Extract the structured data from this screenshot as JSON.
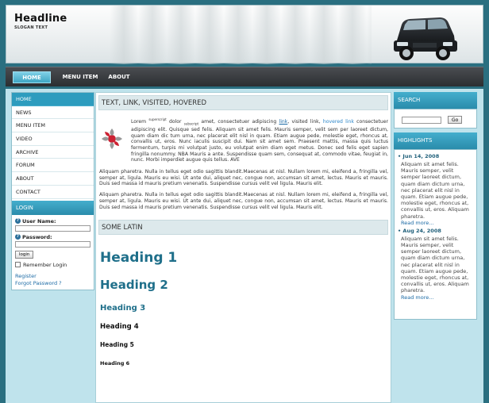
{
  "header": {
    "headline": "Headline",
    "slogan": "SLOGAN TEXT"
  },
  "nav": {
    "items": [
      {
        "label": "HOME"
      },
      {
        "label": "MENU ITEM"
      },
      {
        "label": "ABOUT"
      }
    ],
    "accent_color": "#3fa6c4"
  },
  "sidebar": {
    "items": [
      {
        "label": "HOME"
      },
      {
        "label": "NEWS"
      },
      {
        "label": "MENU ITEM"
      },
      {
        "label": "VIDEO"
      },
      {
        "label": "ARCHIVE"
      },
      {
        "label": "FORUM"
      },
      {
        "label": "ABOUT"
      },
      {
        "label": "CONTACT"
      }
    ],
    "login": {
      "title": "LOGIN",
      "username_label": "User Name:",
      "password_label": "Password:",
      "button_label": "login",
      "remember_label": "Remember Login",
      "register_link": "Register",
      "forgot_link": "Forgot Password ?"
    }
  },
  "main": {
    "section1_title": "TEXT, LINK, VISITED, HOVERED",
    "p1": {
      "t1": "Lorem ",
      "sup": "superscript",
      "t2": " dolor ",
      "sub": "subscript",
      "t3": " amet, consectetuer adipiscing ",
      "link": "link",
      "t4": ", visited link, ",
      "hover": "hovered link",
      "t5": " consectetuer adipiscing elit. Quisque sed felis. Aliquam sit amet felis. Mauris semper, velit sem per laoreet dictum, quam diam dic tum urna, nec placerat elit nisl in quam. Etiam augue pede, molestie eget, rhoncus at, convallis ut, eros. Nunc iaculis suscipit dui. Nam sit amet sem. Praesent mattis, massa quis luctus fermentum, turpis mi volutpat justo, eu volutpat enim diam eget metus. Donec sed felis eget sapien fringilla nonummy. NBA Mauris a ante. Suspendisse quam sem, consequat at, commodo vitae, feugiat in, nunc. Morbi imperdiet augue quis tellus. AVE"
    },
    "p2": "Aliquam pharetra. Nulla in tellus eget odio sagittis blandit.Maecenas at nisl. Nullam lorem mi, eleifend a, fringilla vel, semper at, ligula. Mauris eu wisi. Ut ante dui, aliquet nec, congue non, accumsan sit amet, lectus. Mauris et mauris. Duis sed massa id mauris pretium venenatis. Suspendisse cursus velit vel ligula. Mauris elit.",
    "p3": "Aliquam pharetra. Nulla in tellus eget odio sagittis blandit.Maecenas at nisl. Nullam lorem mi, eleifend a, fringilla vel, semper at, ligula. Mauris eu wisi. Ut ante dui, aliquet nec, congue non, accumsan sit amet, lectus. Mauris et mauris. Duis sed massa id mauris pretium venenatis. Suspendisse cursus velit vel ligula. Mauris elit.",
    "section2_title": "SOME LATIN",
    "headings": {
      "h1": "Heading 1",
      "h2": "Heading 2",
      "h3": "Heading 3",
      "h4": "Heading 4",
      "h5": "Heading 5",
      "h6": "Heading 6"
    }
  },
  "right": {
    "search_title": "SEARCH",
    "search_button": "Go",
    "highlights_title": "HIGHLIGHTS",
    "highlights": [
      {
        "date": "Jun 14, 2008",
        "text": "Aliquam sit amet felis. Mauris semper, velit semper laoreet dictum, quam diam dictum urna, nec placerat elit nisl in quam. Etiam augue pede, molestie eget, rhoncus at, convallis ut, eros. Aliquam pharetra.",
        "more": "Read more..."
      },
      {
        "date": "Aug 24, 2008",
        "text": "Aliquam sit amet felis. Mauris semper, velit semper laoreet dictum, quam diam dictum urna, nec placerat elit nisl in quam. Etiam augue pede, molestie eget, rhoncus at, convallis ut, eros. Aliquam pharetra.",
        "more": "Read more..."
      }
    ]
  }
}
